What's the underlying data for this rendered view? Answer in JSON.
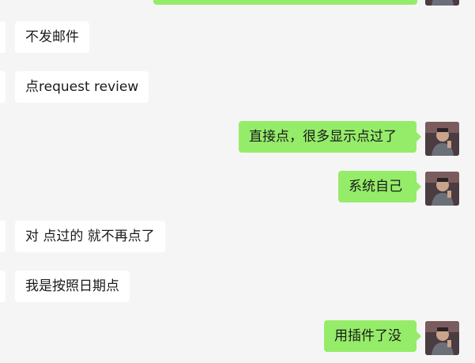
{
  "chat": {
    "messages": [
      {
        "side": "in",
        "text": "不发邮件"
      },
      {
        "side": "in",
        "text": "点request review"
      },
      {
        "side": "out",
        "text": "直接点，很多显示点过了"
      },
      {
        "side": "out",
        "text": "系统自己"
      },
      {
        "side": "in",
        "text": "对 点过的 就不再点了"
      },
      {
        "side": "in",
        "text": "我是按照日期点"
      },
      {
        "side": "out",
        "text": "用插件了没"
      }
    ]
  },
  "colors": {
    "background": "#f5f5f5",
    "incoming_bubble": "#ffffff",
    "outgoing_bubble": "#95ec69",
    "text": "#1a1a1a"
  },
  "icons": {
    "avatar": "user-avatar-photo"
  }
}
